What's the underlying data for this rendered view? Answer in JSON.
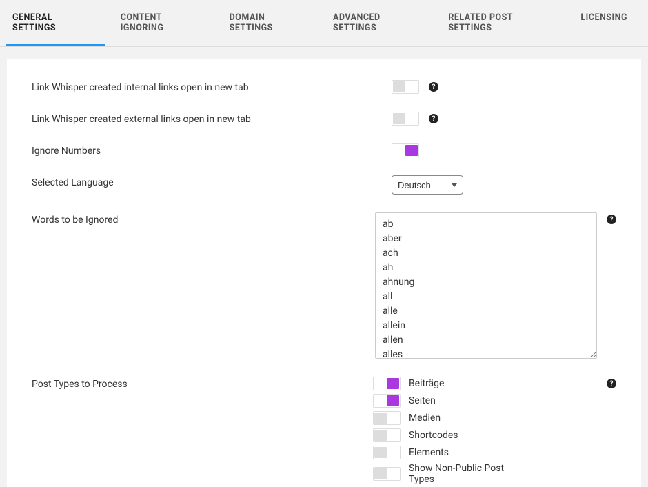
{
  "tabs": {
    "general": "GENERAL SETTINGS",
    "content": "CONTENT IGNORING",
    "domain": "DOMAIN SETTINGS",
    "advanced": "ADVANCED SETTINGS",
    "related": "RELATED POST SETTINGS",
    "licensing": "LICENSING"
  },
  "settings": {
    "internal_new_tab_label": "Link Whisper created internal links open in new tab",
    "external_new_tab_label": "Link Whisper created external links open in new tab",
    "ignore_numbers_label": "Ignore Numbers",
    "selected_language_label": "Selected Language",
    "words_ignored_label": "Words to be Ignored",
    "post_types_label": "Post Types to Process"
  },
  "language": {
    "selected": "Deutsch"
  },
  "ignored_words": "ab\naber\nach\nah\nahnung\nall\nalle\nallein\nallen\nalles",
  "post_types": {
    "beitraege": "Beiträge",
    "seiten": "Seiten",
    "medien": "Medien",
    "shortcodes": "Shortcodes",
    "elements": "Elements",
    "nonpublic": "Show Non-Public Post Types"
  },
  "help_glyph": "?"
}
